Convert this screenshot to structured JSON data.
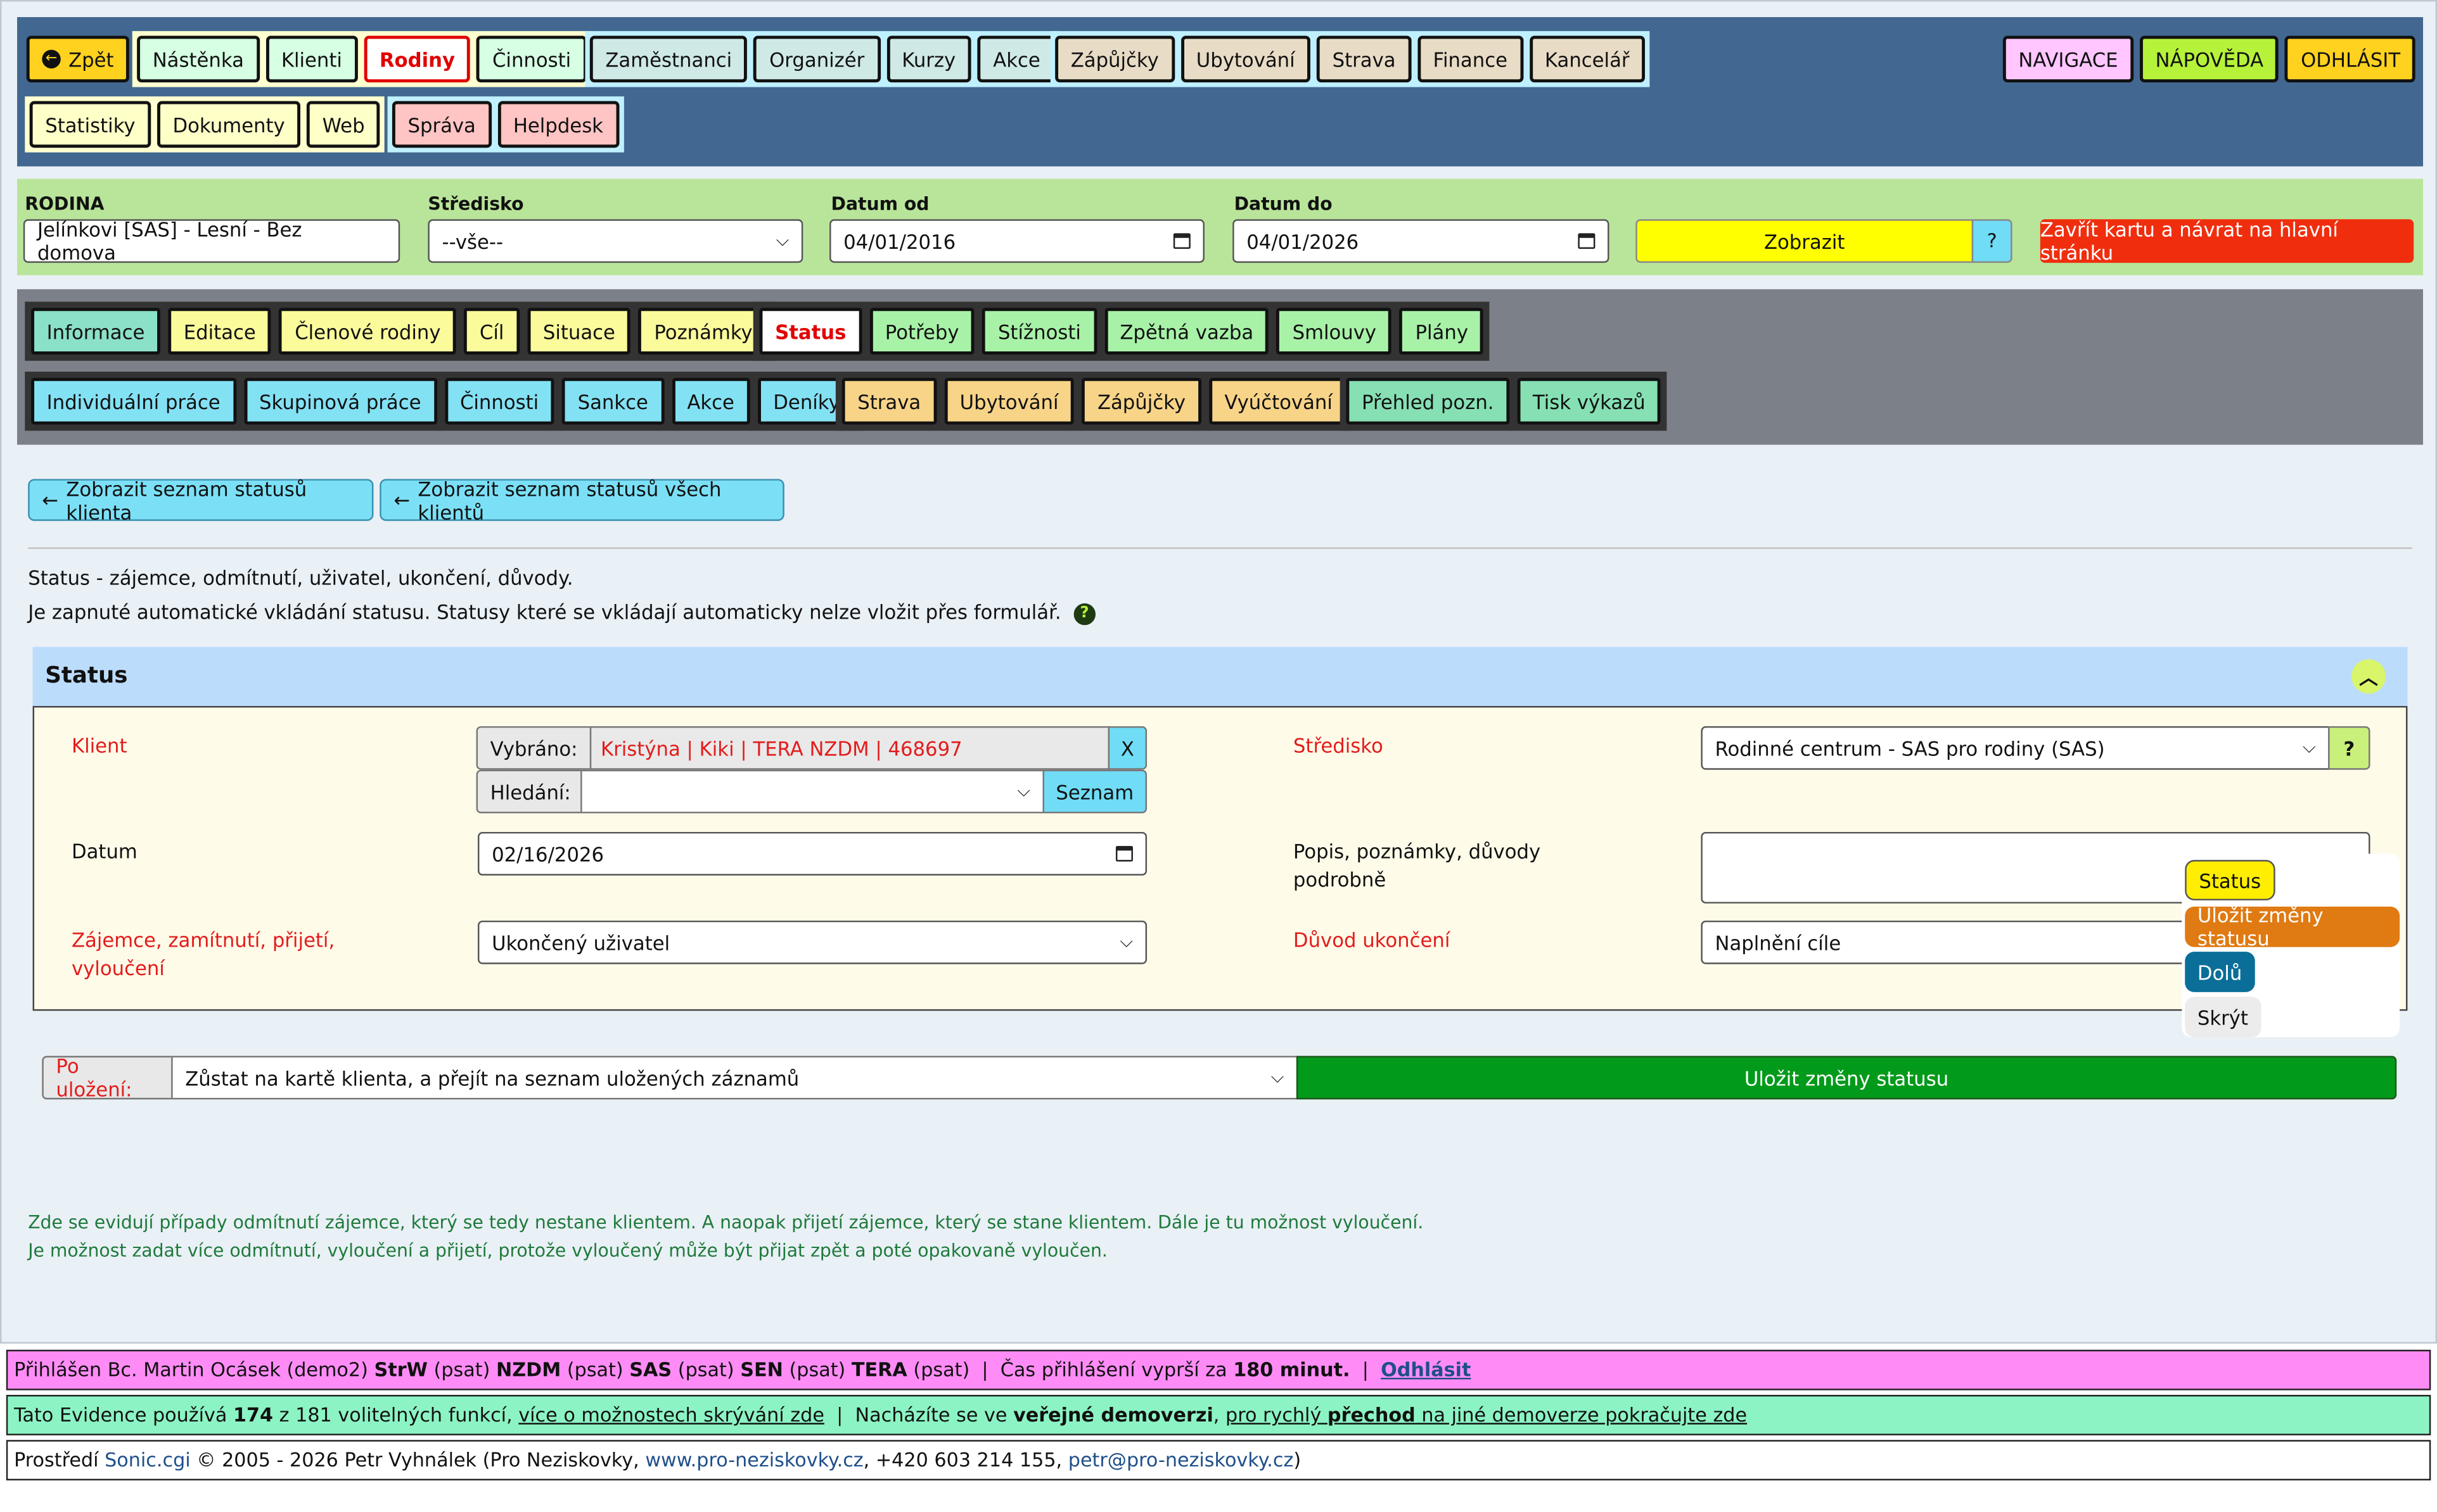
{
  "nav": {
    "back": "Zpět",
    "group1": [
      "Nástěnka",
      "Klienti",
      "Rodiny",
      "Činnosti"
    ],
    "group2": [
      "Zaměstnanci",
      "Organizér",
      "Kurzy",
      "Akce"
    ],
    "group3": [
      "Zápůjčky",
      "Ubytování",
      "Strava",
      "Finance",
      "Kancelář"
    ],
    "group4": [
      "Statistiky",
      "Dokumenty",
      "Web"
    ],
    "group5": [
      "Správa",
      "Helpdesk"
    ],
    "right": [
      "NAVIGACE",
      "NÁPOVĚDA",
      "ODHLÁSIT"
    ]
  },
  "filter": {
    "rodina_label": "RODINA",
    "rodina_value": "Jelínkovi [SAS] - Lesní - Bez domova",
    "stredisko_label": "Středisko",
    "stredisko_value": "--vše--",
    "datum_od_label": "Datum od",
    "datum_od_value": "04/01/2016",
    "datum_do_label": "Datum do",
    "datum_do_value": "04/01/2026",
    "show": "Zobrazit",
    "help": "?",
    "close": "Zavřít kartu a návrat na hlavní stránku"
  },
  "tabs": {
    "row1a": [
      "Informace",
      "Editace",
      "Členové rodiny",
      "Cíl",
      "Situace",
      "Poznámky"
    ],
    "row1b": [
      "Status",
      "Potřeby",
      "Stížnosti",
      "Zpětná vazba",
      "Smlouvy",
      "Plány"
    ],
    "row2a": [
      "Individuální práce",
      "Skupinová práce",
      "Činnosti",
      "Sankce",
      "Akce",
      "Deníky"
    ],
    "row2b": [
      "Strava",
      "Ubytování",
      "Zápůjčky",
      "Vyúčtování"
    ],
    "row2c": [
      "Přehled pozn.",
      "Tisk výkazů"
    ]
  },
  "back_buttons": [
    "Zobrazit seznam statusů klienta",
    "Zobrazit seznam statusů všech klientů"
  ],
  "intro": {
    "line1": "Status - zájemce, odmítnutí, uživatel, ukončení, důvody.",
    "line2": "Je zapnuté automatické vkládání statusu. Statusy které se vkládají automaticky nelze vložit přes formulář."
  },
  "panel": {
    "title": "Status",
    "klient_label": "Klient",
    "vybrano_label": "Vybráno:",
    "vybrano_value": "Kristýna | Kiki | TERA NZDM | 468697",
    "clear": "X",
    "hledani_label": "Hledání:",
    "hledani_value": "",
    "seznam": "Seznam",
    "stredisko_label": "Středisko",
    "stredisko_value": "Rodinné centrum - SAS pro rodiny (SAS)",
    "stredisko_help": "?",
    "datum_label": "Datum",
    "datum_value": "02/16/2026",
    "popis_label1": "Popis, poznámky, důvody",
    "popis_label2": "podrobně",
    "popis_value": "",
    "zajemce_label1": "Zájemce, zamítnutí, přijetí,",
    "zajemce_label2": "vyloučení",
    "zajemce_value": "Ukončený uživatel",
    "duvod_label": "Důvod ukončení",
    "duvod_value": "Naplnění cíle"
  },
  "float_menu": {
    "status": "Status",
    "save": "Uložit změny statusu",
    "down": "Dolů",
    "hide": "Skrýt"
  },
  "save_bar": {
    "label": "Po uložení:",
    "option": "Zůstat na kartě klienta, a přejít na seznam uložených záznamů",
    "save": "Uložit změny statusu"
  },
  "notes": {
    "line1": "Zde se evidují případy odmítnutí zájemce, který se tedy nestane klientem. A naopak přijetí zájemce, který se stane klientem. Dále je tu možnost vyloučení.",
    "line2": "Je možnost zadat více odmítnutí, vyloučení a přijetí, protože vyloučený může být přijat zpět a poté opakovaně vyloučen."
  },
  "footer": {
    "l1_a": "Přihlášen Bc. Martin Ocásek (demo2) ",
    "l1_b": "StrW",
    "l1_c": " (psat) ",
    "l1_d": "NZDM",
    "l1_e": " (psat) ",
    "l1_f": "SAS",
    "l1_g": " (psat) ",
    "l1_h": "SEN",
    "l1_i": " (psat) ",
    "l1_j": "TERA",
    "l1_k": " (psat)  |  Čas přihlášení vyprší za ",
    "l1_l": "180 minut.",
    "l1_m": "  |  ",
    "l1_logout": "Odhlásit",
    "l2_a": "Tato Evidence používá ",
    "l2_b": "174",
    "l2_c": " z 181 volitelných funkcí, ",
    "l2_link1": "více o možnostech skrývání zde",
    "l2_d": "  |  Nacházíte se ve ",
    "l2_e": "veřejné demoverzi",
    "l2_f": ", ",
    "l2_link2a": "pro rychlý ",
    "l2_link2b": "přechod",
    "l2_link2c": " na jiné demoverze pokračujte zde",
    "l3_a": "Prostředí ",
    "l3_sonic": "Sonic.cgi",
    "l3_b": " © 2005 - 2026 Petr Vyhnálek (Pro Neziskovky, ",
    "l3_web": "www.pro-neziskovky.cz",
    "l3_c": ", +420 603 214 155, ",
    "l3_mail": "petr@pro-neziskovky.cz",
    "l3_d": ")"
  },
  "colors": {
    "nav_bg": "#426891",
    "filter_bg": "#b9e59a",
    "tabs_bg": "#7c8089",
    "save_green": "#029a1a",
    "close_red": "#f02e0e"
  }
}
